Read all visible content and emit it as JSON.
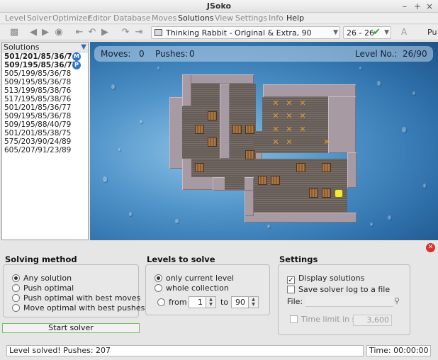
{
  "window": {
    "title": "JSoko",
    "minimize": "–",
    "maximize": "+",
    "close": "×"
  },
  "menu": [
    "Level",
    "Solver",
    "Optimizer",
    "Editor",
    "Database",
    "Moves",
    "Solutions",
    "View",
    "Settings",
    "Info",
    "Help"
  ],
  "toolbar": {
    "level_select": "Thinking Rabbit - Original & Extra, 90",
    "counter": "26 - 26",
    "font_button": "A",
    "cut_label": "Pu"
  },
  "solutions": {
    "header": "Solutions",
    "items": [
      {
        "text": "501/201/85/36/76",
        "badge": "M",
        "bold": true
      },
      {
        "text": "509/195/85/36/77",
        "badge": "P",
        "bold": true
      },
      {
        "text": "505/199/85/36/78"
      },
      {
        "text": "509/195/85/36/78"
      },
      {
        "text": "513/199/85/38/76"
      },
      {
        "text": "517/195/85/38/76"
      },
      {
        "text": "501/201/85/36/77"
      },
      {
        "text": "509/195/85/36/78"
      },
      {
        "text": "509/195/88/40/79"
      },
      {
        "text": "501/201/85/38/75"
      },
      {
        "text": "575/203/90/24/89"
      },
      {
        "text": "605/207/91/23/89"
      }
    ]
  },
  "game": {
    "moves_label": "Moves:",
    "moves": "0",
    "pushes_label": "Pushes:",
    "pushes": "0",
    "level_label": "Level No.:",
    "level": "26/90"
  },
  "solving_method": {
    "title": "Solving method",
    "options": [
      "Any solution",
      "Push optimal",
      "Push optimal with best moves",
      "Move optimal with best pushes"
    ],
    "selected": 0
  },
  "levels_to_solve": {
    "title": "Levels to solve",
    "options": [
      "only current level",
      "whole collection"
    ],
    "selected": 0,
    "from_label": "from",
    "from_value": "1",
    "to_label": "to",
    "to_value": "90"
  },
  "settings": {
    "title": "Settings",
    "display_solutions": "Display solutions",
    "save_log": "Save solver log to a file",
    "file_label": "File:",
    "time_limit_label": "Time limit in s",
    "time_limit_value": "3,600"
  },
  "start_button": "Start solver",
  "status": {
    "message": "Level solved! Pushes: 207",
    "time": "Time: 00:00:00"
  },
  "colors": {
    "accent": "#2f74d0",
    "ok": "#2ea82e",
    "close": "#d9322c"
  },
  "icons": [
    "folder-icon",
    "back-icon",
    "forward-icon",
    "binoculars-icon",
    "undo-all-icon",
    "undo-icon",
    "play-icon",
    "redo-icon",
    "redo-all-icon",
    "level-icon",
    "check-icon",
    "pin-icon",
    "search-icon"
  ]
}
